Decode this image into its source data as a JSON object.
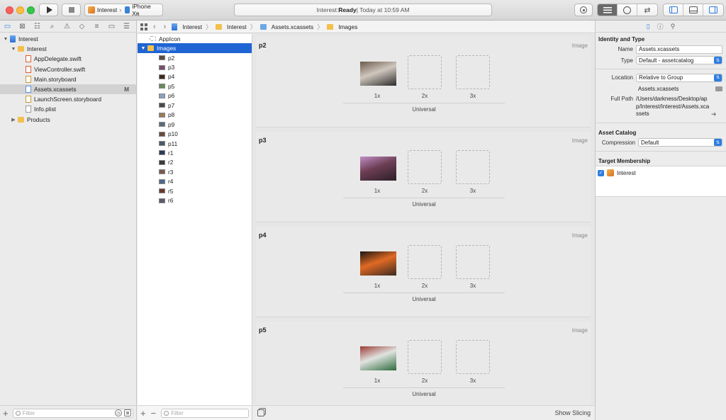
{
  "toolbar": {
    "scheme_target": "Interest",
    "scheme_device": "iPhone Xʀ",
    "status_prefix": "Interest: ",
    "status_state": "Ready",
    "status_suffix": " | Today at 10:59 AM"
  },
  "navigator": {
    "items": [
      {
        "label": "Interest",
        "level": 0,
        "icon": "project-icon",
        "disclosure": "▼"
      },
      {
        "label": "Interest",
        "level": 1,
        "icon": "folder-icon",
        "disclosure": "▼"
      },
      {
        "label": "AppDelegate.swift",
        "level": 2,
        "icon": "swift-file-icon",
        "disclosure": ""
      },
      {
        "label": "ViewController.swift",
        "level": 2,
        "icon": "swift-file-icon",
        "disclosure": ""
      },
      {
        "label": "Main.storyboard",
        "level": 2,
        "icon": "storyboard-icon",
        "disclosure": ""
      },
      {
        "label": "Assets.xcassets",
        "level": 2,
        "icon": "asset-catalog-icon",
        "disclosure": "",
        "selected": true,
        "badge": "M"
      },
      {
        "label": "LaunchScreen.storyboard",
        "level": 2,
        "icon": "storyboard-icon",
        "disclosure": ""
      },
      {
        "label": "Info.plist",
        "level": 2,
        "icon": "plist-icon",
        "disclosure": ""
      },
      {
        "label": "Products",
        "level": 1,
        "icon": "folder-icon",
        "disclosure": "▶"
      }
    ],
    "filter_placeholder": "Filter"
  },
  "jumpbar": {
    "crumbs": [
      "Interest",
      "Interest",
      "Assets.xcassets",
      "Images"
    ]
  },
  "asset_list": {
    "appicon": "AppIcon",
    "group": "Images",
    "items": [
      "p2",
      "p3",
      "p4",
      "p5",
      "p6",
      "p7",
      "p8",
      "p9",
      "p10",
      "p11",
      "r1",
      "r2",
      "r3",
      "r4",
      "r5",
      "r6"
    ],
    "filter_placeholder": "Filter"
  },
  "canvas": {
    "sets": [
      {
        "name": "p2",
        "kind": "Image",
        "scales": [
          "1x",
          "2x",
          "3x"
        ],
        "group": "Universal",
        "photo_colors": [
          "#6b5a4c",
          "#cfc7bd",
          "#2c2a2b"
        ]
      },
      {
        "name": "p3",
        "kind": "Image",
        "scales": [
          "1x",
          "2x",
          "3x"
        ],
        "group": "Universal",
        "photo_colors": [
          "#c28fc8",
          "#6d3e54",
          "#2b1f28"
        ]
      },
      {
        "name": "p4",
        "kind": "Image",
        "scales": [
          "1x",
          "2x",
          "3x"
        ],
        "group": "Universal",
        "photo_colors": [
          "#1a1512",
          "#e06a24",
          "#3b2a20"
        ]
      },
      {
        "name": "p5",
        "kind": "Image",
        "scales": [
          "1x",
          "2x",
          "3x"
        ],
        "group": "Universal",
        "photo_colors": [
          "#9c3a34",
          "#dfe3e0",
          "#2c6a3a"
        ]
      }
    ],
    "show_slicing": "Show Slicing"
  },
  "inspector": {
    "identity_title": "Identity and Type",
    "name_label": "Name",
    "name_value": "Assets.xcassets",
    "type_label": "Type",
    "type_value": "Default - assetcatalog",
    "location_label": "Location",
    "location_value": "Relative to Group",
    "location_file": "Assets.xcassets",
    "fullpath_label": "Full Path",
    "fullpath_value": "/Users/darkness/Desktop/app/Interest/Interest/Assets.xcassets",
    "catalog_title": "Asset Catalog",
    "compression_label": "Compression",
    "compression_value": "Default",
    "membership_title": "Target Membership",
    "membership_target": "Interest"
  }
}
